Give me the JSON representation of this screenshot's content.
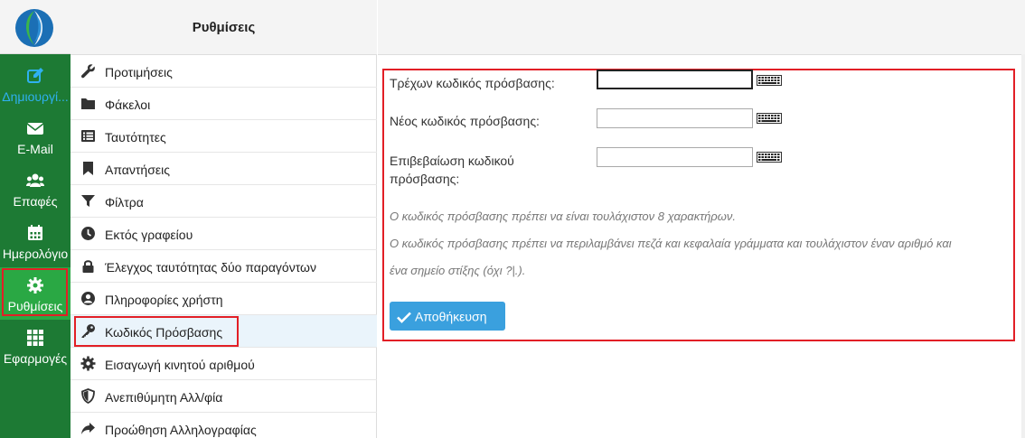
{
  "rail": {
    "items": [
      {
        "label": "Δημιουργί...",
        "icon": "edit-icon"
      },
      {
        "label": "E-Mail",
        "icon": "envelope-icon"
      },
      {
        "label": "Επαφές",
        "icon": "users-icon"
      },
      {
        "label": "Ημερολόγιο",
        "icon": "calendar-icon"
      },
      {
        "label": "Ρυθμίσεις",
        "icon": "gear-icon",
        "active": true
      },
      {
        "label": "Εφαρμογές",
        "icon": "grid-icon"
      }
    ]
  },
  "settings": {
    "title": "Ρυθμίσεις",
    "items": [
      {
        "label": "Προτιμήσεις",
        "icon": "wrench-icon"
      },
      {
        "label": "Φάκελοι",
        "icon": "folder-icon"
      },
      {
        "label": "Ταυτότητες",
        "icon": "id-list-icon"
      },
      {
        "label": "Απαντήσεις",
        "icon": "bookmark-icon"
      },
      {
        "label": "Φίλτρα",
        "icon": "filter-icon"
      },
      {
        "label": "Εκτός γραφείου",
        "icon": "clock-icon"
      },
      {
        "label": "Έλεγχος ταυτότητας δύο παραγόντων",
        "icon": "lock-icon"
      },
      {
        "label": "Πληροφορίες χρήστη",
        "icon": "user-circle-icon"
      },
      {
        "label": "Κωδικός Πρόσβασης",
        "icon": "key-icon",
        "selected": true
      },
      {
        "label": "Εισαγωγή κινητού αριθμού",
        "icon": "cog-icon"
      },
      {
        "label": "Ανεπιθύμητη Αλλ/φία",
        "icon": "shield-icon"
      },
      {
        "label": "Προώθηση Αλληλογραφίας",
        "icon": "share-arrow-icon"
      }
    ]
  },
  "form": {
    "current_label": "Τρέχων κωδικός πρόσβασης:",
    "current_value": "",
    "new_label": "Νέος κωδικός πρόσβασης:",
    "new_value": "",
    "confirm_label_line1": "Επιβεβαίωση κωδικού",
    "confirm_label_line2": "πρόσβασης:",
    "confirm_value": "",
    "note1": "Ο κωδικός πρόσβασης πρέπει να είναι τουλάχιστον 8 χαρακτήρων.",
    "note2_line1": "Ο κωδικός πρόσβασης πρέπει να περιλαμβάνει πεζά και κεφαλαία γράμματα και τουλάχιστον έναν αριθμό και",
    "note2_line2": "ένα σημείο στίξης (όχι ?|.).",
    "save_label": "Αποθήκευση",
    "keyboard_icon": "keyboard-icon",
    "save_icon": "check-icon"
  },
  "colors": {
    "rail_green": "#1d7a34",
    "rail_active": "#2aa844",
    "highlight_red": "#e21f26",
    "button_blue": "#3aa0de",
    "selected_row": "#eaf4fb"
  }
}
